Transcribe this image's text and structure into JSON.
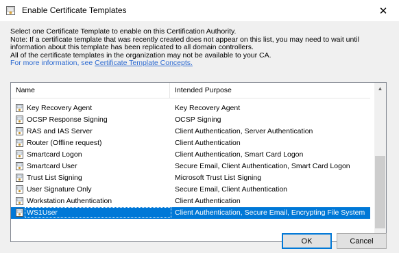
{
  "window": {
    "title": "Enable Certificate Templates",
    "close_glyph": "✕"
  },
  "description": {
    "line1": "Select one Certificate Template to enable on this Certification Authority.",
    "line2": "Note: If a certificate template that was recently created does not appear on this list, you may need to wait until",
    "line3": "information about this template has been replicated to all domain controllers.",
    "line4": "All of the certificate templates in the organization may not be available to your CA.",
    "more_prefix": "For more information, see ",
    "more_link": "Certificate Template Concepts."
  },
  "list": {
    "columns": [
      "Name",
      "Intended Purpose"
    ],
    "rows": [
      {
        "name": "Key Recovery Agent",
        "purpose": "Key Recovery Agent"
      },
      {
        "name": "OCSP Response Signing",
        "purpose": "OCSP Signing"
      },
      {
        "name": "RAS and IAS Server",
        "purpose": "Client Authentication, Server Authentication"
      },
      {
        "name": "Router (Offline request)",
        "purpose": "Client Authentication"
      },
      {
        "name": "Smartcard Logon",
        "purpose": "Client Authentication, Smart Card Logon"
      },
      {
        "name": "Smartcard User",
        "purpose": "Secure Email, Client Authentication, Smart Card Logon"
      },
      {
        "name": "Trust List Signing",
        "purpose": "Microsoft Trust List Signing"
      },
      {
        "name": "User Signature Only",
        "purpose": "Secure Email, Client Authentication"
      },
      {
        "name": "Workstation Authentication",
        "purpose": "Client Authentication"
      },
      {
        "name": "WS1User",
        "purpose": "Client Authentication, Secure Email, Encrypting File System"
      }
    ],
    "selected_index": 9,
    "icon": "certificate-template-icon",
    "scroll_up_glyph": "▲",
    "scroll_down_glyph": "▼"
  },
  "buttons": {
    "ok": "OK",
    "cancel": "Cancel"
  },
  "colors": {
    "selection": "#0078d7",
    "link": "#2e6bd1",
    "dialog_bg": "#f0f0f0"
  }
}
